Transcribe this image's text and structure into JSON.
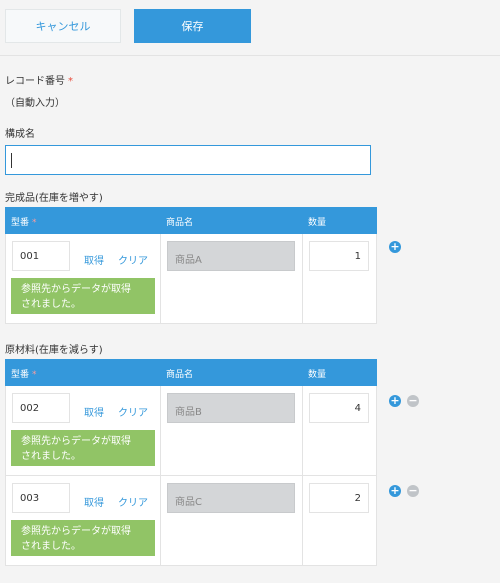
{
  "toolbar": {
    "cancel_label": "キャンセル",
    "save_label": "保存"
  },
  "record_number": {
    "label": "レコード番号",
    "required_mark": "*",
    "value": "（自動入力）"
  },
  "config_name": {
    "label": "構成名",
    "value": ""
  },
  "finished": {
    "title": "完成品(在庫を増やす)",
    "headers": {
      "code": "型番",
      "required_mark": "*",
      "product": "商品名",
      "quantity": "数量"
    },
    "rows": [
      {
        "code": "001",
        "fetch": "取得",
        "clear": "クリア",
        "product": "商品A",
        "quantity": "1",
        "message_line1": "参照先からデータが取得",
        "message_line2": "されました。"
      }
    ]
  },
  "materials": {
    "title": "原材料(在庫を減らす)",
    "headers": {
      "code": "型番",
      "required_mark": "*",
      "product": "商品名",
      "quantity": "数量"
    },
    "rows": [
      {
        "code": "002",
        "fetch": "取得",
        "clear": "クリア",
        "product": "商品B",
        "quantity": "4",
        "message_line1": "参照先からデータが取得",
        "message_line2": "されました。"
      },
      {
        "code": "003",
        "fetch": "取得",
        "clear": "クリア",
        "product": "商品C",
        "quantity": "2",
        "message_line1": "参照先からデータが取得",
        "message_line2": "されました。"
      }
    ]
  },
  "icons": {
    "add": "+",
    "remove": "−"
  },
  "colors": {
    "accent": "#3498db",
    "success": "#91c466",
    "required": "#e74c3c"
  }
}
